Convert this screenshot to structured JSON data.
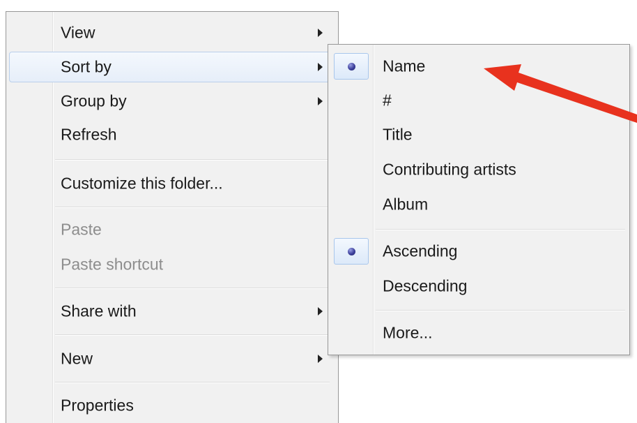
{
  "context_menu": {
    "items": [
      {
        "label": "View",
        "has_submenu": true
      },
      {
        "label": "Sort by",
        "has_submenu": true,
        "highlighted": true
      },
      {
        "label": "Group by",
        "has_submenu": true
      },
      {
        "label": "Refresh"
      },
      {
        "label": "Customize this folder..."
      },
      {
        "label": "Paste",
        "disabled": true
      },
      {
        "label": "Paste shortcut",
        "disabled": true
      },
      {
        "label": "Share with",
        "has_submenu": true
      },
      {
        "label": "New",
        "has_submenu": true
      },
      {
        "label": "Properties"
      }
    ]
  },
  "sort_submenu": {
    "items": [
      {
        "label": "Name",
        "checked": true
      },
      {
        "label": "#"
      },
      {
        "label": "Title"
      },
      {
        "label": "Contributing artists"
      },
      {
        "label": "Album"
      },
      {
        "label": "Ascending",
        "checked": true
      },
      {
        "label": "Descending"
      },
      {
        "label": "More..."
      }
    ]
  },
  "colors": {
    "menu_background": "#f1f1f1",
    "menu_border": "#979797",
    "highlight_border": "#b9cfeb",
    "disabled_text": "#8d8d8d",
    "annotation_arrow": "#e8321e"
  }
}
